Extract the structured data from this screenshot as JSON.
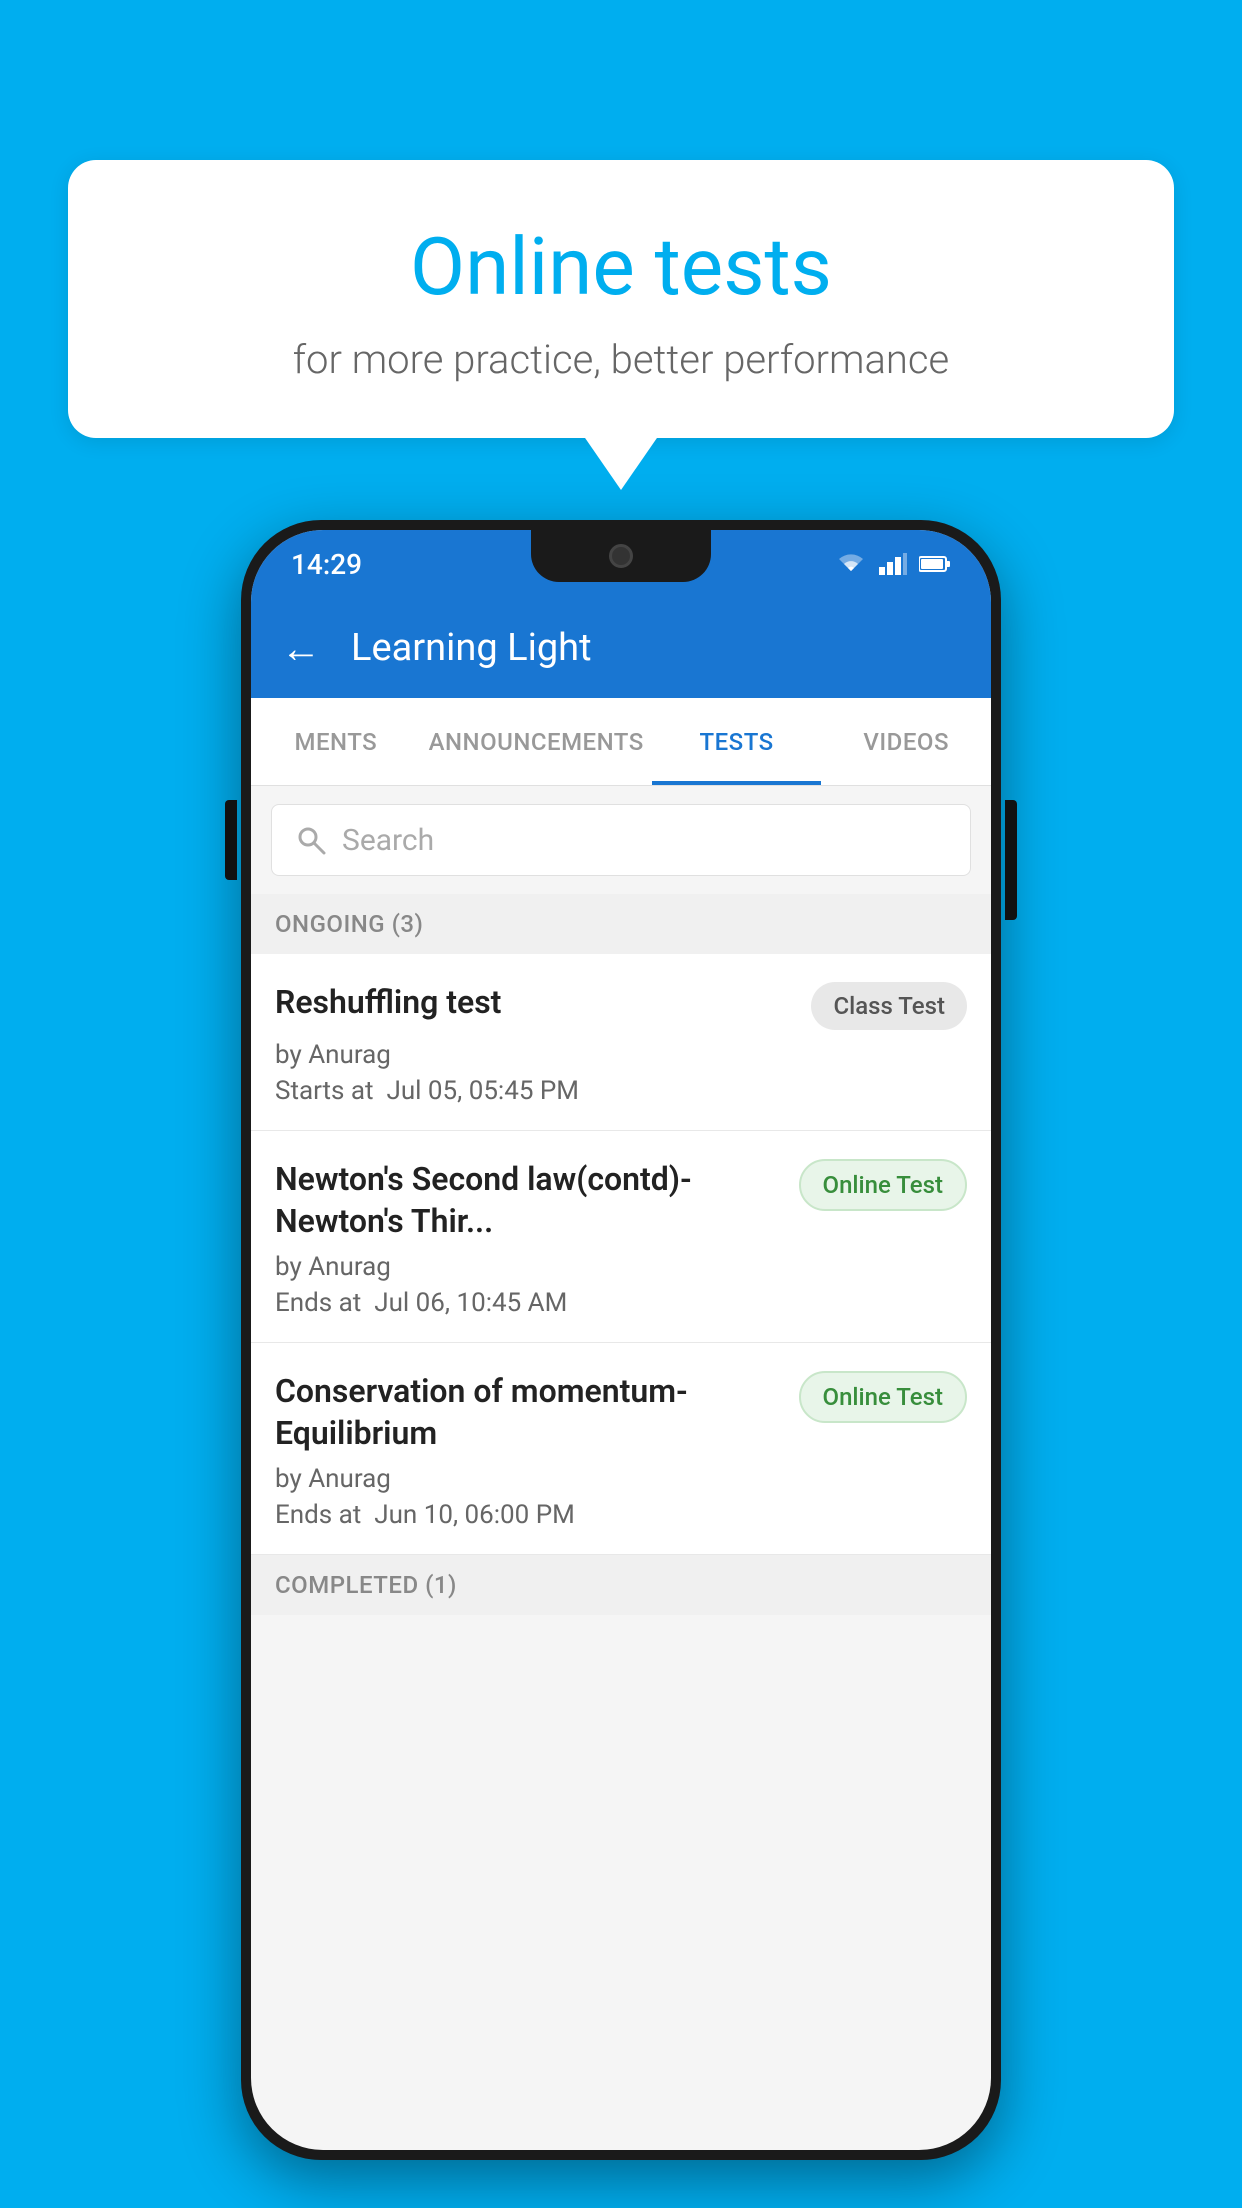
{
  "background_color": "#00AEEF",
  "bubble": {
    "title": "Online tests",
    "subtitle": "for more practice, better performance"
  },
  "status_bar": {
    "time": "14:29",
    "wifi_icon": "▼",
    "signal_icon": "▲",
    "battery_icon": "▮"
  },
  "app_header": {
    "title": "Learning Light",
    "back_label": "←"
  },
  "tabs": [
    {
      "label": "MENTS",
      "active": false
    },
    {
      "label": "ANNOUNCEMENTS",
      "active": false
    },
    {
      "label": "TESTS",
      "active": true
    },
    {
      "label": "VIDEOS",
      "active": false
    }
  ],
  "search": {
    "placeholder": "Search"
  },
  "sections": [
    {
      "header": "ONGOING (3)",
      "items": [
        {
          "name": "Reshuffling test",
          "badge": "Class Test",
          "badge_type": "class",
          "by": "by Anurag",
          "date_label": "Starts at",
          "date": "Jul 05, 05:45 PM"
        },
        {
          "name": "Newton's Second law(contd)-Newton's Thir...",
          "badge": "Online Test",
          "badge_type": "online",
          "by": "by Anurag",
          "date_label": "Ends at",
          "date": "Jul 06, 10:45 AM"
        },
        {
          "name": "Conservation of momentum-Equilibrium",
          "badge": "Online Test",
          "badge_type": "online",
          "by": "by Anurag",
          "date_label": "Ends at",
          "date": "Jun 10, 06:00 PM"
        }
      ]
    }
  ],
  "completed_section": "COMPLETED (1)"
}
